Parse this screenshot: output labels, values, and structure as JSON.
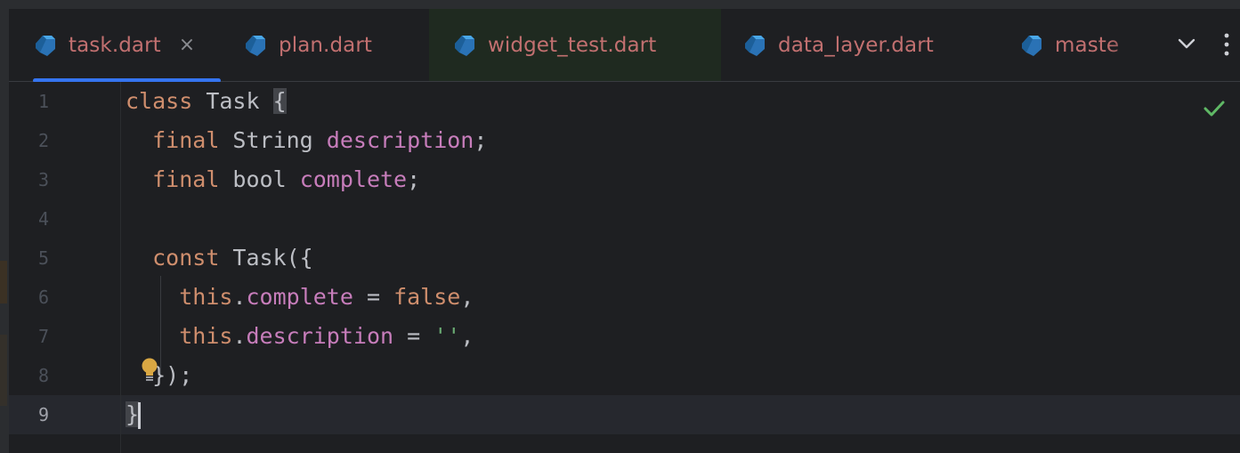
{
  "tabs": [
    {
      "label": "task.dart",
      "active": true,
      "closable": true
    },
    {
      "label": "plan.dart"
    },
    {
      "label": "widget_test.dart"
    },
    {
      "label": "data_layer.dart"
    },
    {
      "label": "maste"
    }
  ],
  "close_glyph": "×",
  "icons": {
    "file": "dart-icon",
    "more_tabs": "chevron-down-icon",
    "menu": "more-vertical-icon",
    "status": "check-icon",
    "intention": "lightbulb-icon"
  },
  "colors": {
    "tab_label": "#c27070",
    "active_tab_underline": "#3574f0",
    "keyword": "#cf8e6d",
    "field": "#c77dbb",
    "string": "#6aab73",
    "status_ok": "#5fb865"
  },
  "editor": {
    "current_line": 9,
    "line_numbers": [
      "1",
      "2",
      "3",
      "4",
      "5",
      "6",
      "7",
      "8",
      "9"
    ],
    "lines": [
      [
        {
          "t": "class",
          "c": "kw"
        },
        {
          "t": " Task "
        },
        {
          "t": "{",
          "c": "brace-hl"
        }
      ],
      [
        {
          "t": "  "
        },
        {
          "t": "final",
          "c": "kw"
        },
        {
          "t": " String "
        },
        {
          "t": "description",
          "c": "fld"
        },
        {
          "t": ";"
        }
      ],
      [
        {
          "t": "  "
        },
        {
          "t": "final",
          "c": "kw"
        },
        {
          "t": " bool "
        },
        {
          "t": "complete",
          "c": "fld"
        },
        {
          "t": ";"
        }
      ],
      [],
      [
        {
          "t": "  "
        },
        {
          "t": "const",
          "c": "kw"
        },
        {
          "t": " Task({"
        }
      ],
      [
        {
          "t": "    "
        },
        {
          "t": "this",
          "c": "kw"
        },
        {
          "t": "."
        },
        {
          "t": "complete",
          "c": "fld"
        },
        {
          "t": " = "
        },
        {
          "t": "false",
          "c": "kw"
        },
        {
          "t": ","
        }
      ],
      [
        {
          "t": "    "
        },
        {
          "t": "this",
          "c": "kw"
        },
        {
          "t": "."
        },
        {
          "t": "description",
          "c": "fld"
        },
        {
          "t": " = "
        },
        {
          "t": "''",
          "c": "str"
        },
        {
          "t": ","
        }
      ],
      [
        {
          "t": "  });"
        }
      ],
      [
        {
          "t": "}",
          "c": "brace-hl"
        }
      ]
    ]
  }
}
